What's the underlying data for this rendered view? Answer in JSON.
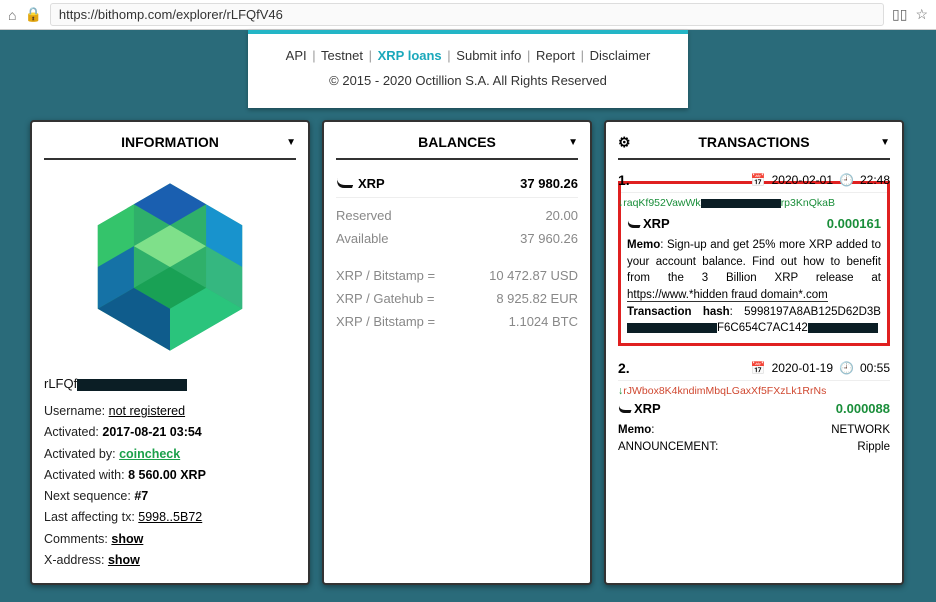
{
  "browser": {
    "url": "https://bithomp.com/explorer/rLFQfV46"
  },
  "footer": {
    "links": [
      "API",
      "Testnet",
      "XRP loans",
      "Submit info",
      "Report",
      "Disclaimer"
    ],
    "copyright": "© 2015 - 2020 Octillion S.A. All Rights Reserved"
  },
  "info": {
    "title": "INFORMATION",
    "address_prefix": "rLFQf",
    "username_label": "Username:",
    "username_value": "not registered",
    "activated_label": "Activated:",
    "activated_value": "2017-08-21 03:54",
    "activated_by_label": "Activated by:",
    "activated_by_value": "coincheck",
    "activated_with_label": "Activated with:",
    "activated_with_value": "8 560.00 XRP",
    "next_seq_label": "Next sequence:",
    "next_seq_value": "#7",
    "last_tx_label": "Last affecting tx:",
    "last_tx_value": "5998..5B72",
    "comments_label": "Comments:",
    "comments_value": "show",
    "xaddr_label": "X-address:",
    "xaddr_value": "show"
  },
  "balances": {
    "title": "BALANCES",
    "main_label": "XRP",
    "main_value": "37 980.26",
    "reserved_label": "Reserved",
    "reserved_value": "20.00",
    "available_label": "Available",
    "available_value": "37 960.26",
    "rates": [
      {
        "pair": "XRP / Bitstamp =",
        "value": "10 472.87 USD"
      },
      {
        "pair": "XRP / Gatehub =",
        "value": "8 925.82 EUR"
      },
      {
        "pair": "XRP / Bitstamp =",
        "value": "1.1024 BTC"
      }
    ]
  },
  "transactions": {
    "title": "TRANSACTIONS",
    "items": [
      {
        "num": "1.",
        "date": "2020-02-01",
        "time": "22:48",
        "addr_pre": "raqKf952VawWk",
        "addr_post": "rp3KnQkaB",
        "currency": "XRP",
        "amount": "0.000161",
        "memo_label": "Memo",
        "memo_text": ": Sign-up and get 25% more XRP added to your account balance. Find out how to benefit from the 3 Billion XRP release at ",
        "memo_url": "https://www.*hidden fraud domain*.com",
        "hash_label": "Transaction hash",
        "hash_pre": ": 5998197A8AB125D62D3B",
        "hash_mid": "F6C654C7AC142"
      },
      {
        "num": "2.",
        "date": "2020-01-19",
        "time": "00:55",
        "addr": "rJWbox8K4kndimMbqLGaxXf5FXzLk1RrNs",
        "currency": "XRP",
        "amount": "0.000088",
        "memo_label": "Memo",
        "memo_text": ": NETWORK ANNOUNCEMENT: Ripple"
      }
    ]
  }
}
